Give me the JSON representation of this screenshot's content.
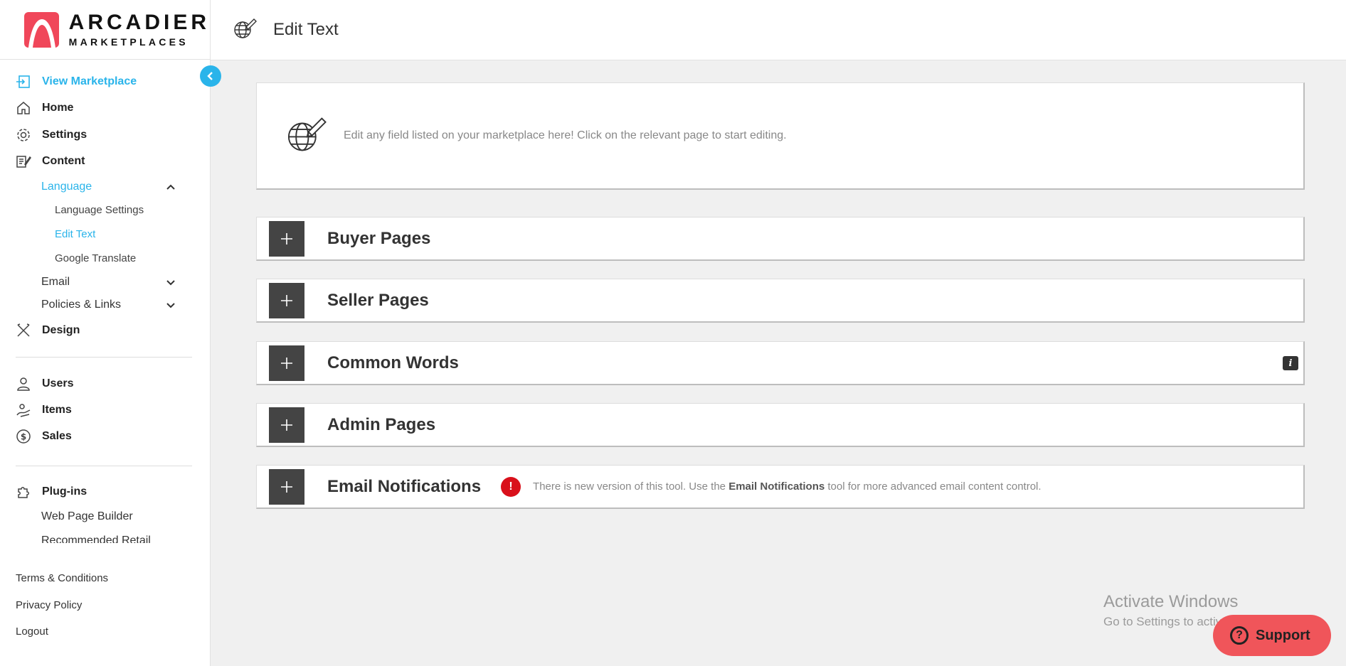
{
  "brand": {
    "name": "ARCADIER",
    "subtitle": "MARKETPLACES"
  },
  "header": {
    "title": "Edit Text",
    "icon": "globe-pencil-icon"
  },
  "sidebar": {
    "items": [
      {
        "label": "View Marketplace",
        "icon": "enter-icon"
      },
      {
        "label": "Home",
        "icon": "home-icon"
      },
      {
        "label": "Settings",
        "icon": "gear-icon"
      },
      {
        "label": "Content",
        "icon": "content-icon"
      },
      {
        "label": "Design",
        "icon": "design-tools-icon"
      },
      {
        "label": "Users",
        "icon": "user-icon"
      },
      {
        "label": "Items",
        "icon": "items-icon"
      },
      {
        "label": "Sales",
        "icon": "dollar-icon"
      },
      {
        "label": "Plug-ins",
        "icon": "puzzle-icon"
      }
    ],
    "content_children": [
      {
        "label": "Language"
      },
      {
        "label": "Email"
      },
      {
        "label": "Policies & Links"
      }
    ],
    "language_children": [
      {
        "label": "Language Settings"
      },
      {
        "label": "Edit Text"
      },
      {
        "label": "Google Translate"
      }
    ],
    "plugin_children": [
      {
        "label": "Web Page Builder"
      },
      {
        "label": "Recommended Retail"
      }
    ],
    "footer": [
      {
        "label": "Terms & Conditions"
      },
      {
        "label": "Privacy Policy"
      },
      {
        "label": "Logout"
      }
    ]
  },
  "intro": {
    "text": "Edit any field listed on your marketplace here! Click on the relevant page to start editing."
  },
  "sections": [
    {
      "title": "Buyer Pages"
    },
    {
      "title": "Seller Pages"
    },
    {
      "title": "Common Words",
      "info": "i"
    },
    {
      "title": "Admin Pages"
    },
    {
      "title": "Email Notifications"
    }
  ],
  "alert": {
    "icon_text": "!",
    "text_before": "There is new version of this tool. Use the ",
    "text_bold": "Email Notifications",
    "text_after": " tool for more advanced email content control."
  },
  "watermark": {
    "line1": "Activate Windows",
    "line2": "Go to Settings to activate Windows."
  },
  "support": {
    "label": "Support",
    "icon_text": "?"
  },
  "colors": {
    "accent": "#2ab4ea",
    "brand": "#f0475a",
    "alert": "#d9101b",
    "toggle": "#444444",
    "support": "#f0555a"
  }
}
